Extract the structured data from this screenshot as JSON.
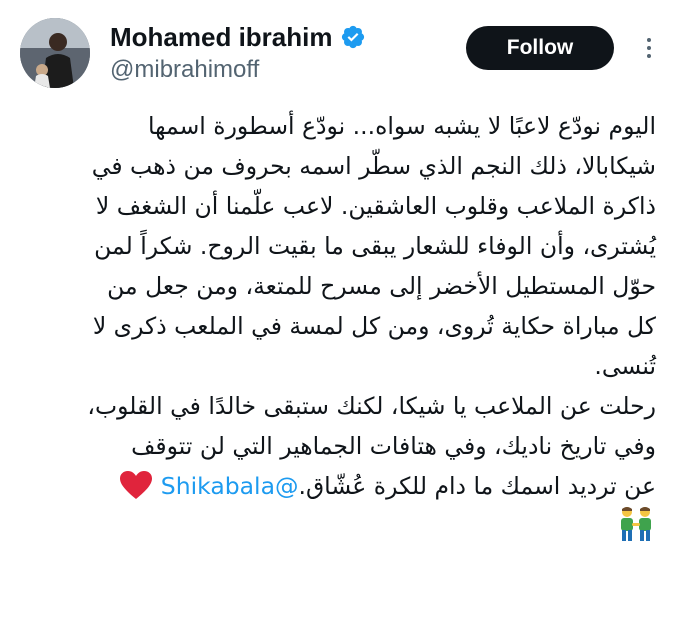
{
  "author": {
    "display_name": "Mohamed ibrahim",
    "handle": "@mibrahimoff",
    "verified": true
  },
  "actions": {
    "follow_label": "Follow"
  },
  "tweet": {
    "lines": [
      "اليوم نودّع لاعبًا لا يشبه سواه... نودّع أسطورة اسمها",
      "شيكابالا، ذلك النجم الذي سطّر اسمه بحروف من ذهب في",
      "ذاكرة الملاعب وقلوب العاشقين. لاعب علّمنا أن الشغف لا",
      "يُشترى، وأن الوفاء للشعار يبقى ما بقيت الروح. شكراً لمن",
      "حوّل المستطيل الأخضر إلى مسرح للمتعة، ومن جعل من",
      "كل مباراة حكاية تُروى، ومن كل لمسة في الملعب ذكرى لا",
      "تُنسى.",
      "رحلت عن الملاعب يا شيكا، لكنك ستبقى خالدًا في القلوب،",
      "وفي تاريخ ناديك، وفي هتافات الجماهير التي لن تتوقف"
    ],
    "last_line_text": "عن ترديد اسمك ما دام للكرة عُشّاق.",
    "mention": "@Shikabala",
    "heart_emoji": "heart-icon",
    "people_emoji": "two-men-holding-hands-icon"
  },
  "colors": {
    "text": "#0f1419",
    "secondary": "#536471",
    "accent": "#1d9bf0",
    "follow_bg": "#0f1419",
    "heart": "#e0243c"
  }
}
